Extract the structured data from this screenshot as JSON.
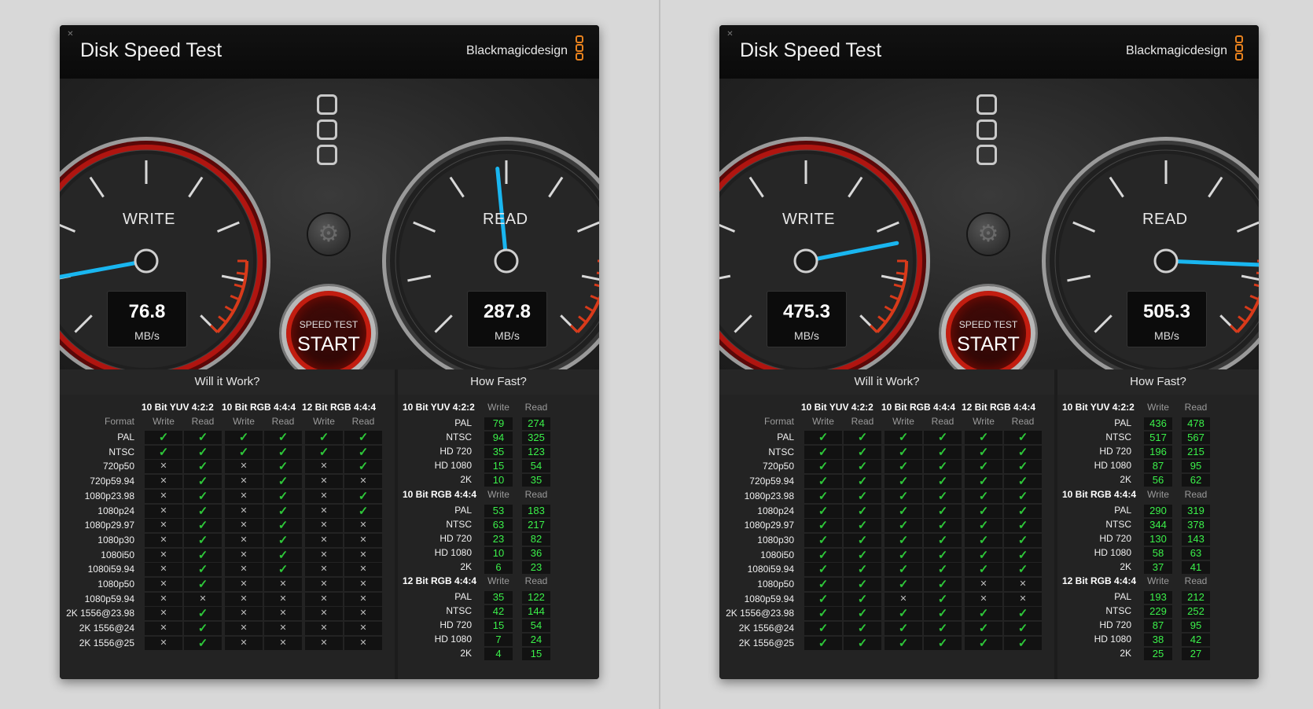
{
  "windows": [
    {
      "title": "Disk Speed Test",
      "brand": "Blackmagicdesign",
      "write": {
        "label": "WRITE",
        "value": "76.8",
        "unit": "MB/s",
        "speed": 76.8
      },
      "read": {
        "label": "READ",
        "value": "287.8",
        "unit": "MB/s",
        "speed": 287.8
      },
      "start": {
        "small": "SPEED TEST",
        "big": "START"
      },
      "will_it_work": {
        "title": "Will it Work?",
        "format_label": "Format",
        "groups": [
          "10 Bit YUV 4:2:2",
          "10 Bit RGB 4:4:4",
          "12 Bit RGB 4:4:4"
        ],
        "subheads": [
          "Write",
          "Read"
        ],
        "rows": [
          {
            "format": "PAL",
            "v": [
              1,
              1,
              1,
              1,
              1,
              1
            ]
          },
          {
            "format": "NTSC",
            "v": [
              1,
              1,
              1,
              1,
              1,
              1
            ]
          },
          {
            "format": "720p50",
            "v": [
              0,
              1,
              0,
              1,
              0,
              1
            ]
          },
          {
            "format": "720p59.94",
            "v": [
              0,
              1,
              0,
              1,
              0,
              0
            ]
          },
          {
            "format": "1080p23.98",
            "v": [
              0,
              1,
              0,
              1,
              0,
              1
            ]
          },
          {
            "format": "1080p24",
            "v": [
              0,
              1,
              0,
              1,
              0,
              1
            ]
          },
          {
            "format": "1080p29.97",
            "v": [
              0,
              1,
              0,
              1,
              0,
              0
            ]
          },
          {
            "format": "1080p30",
            "v": [
              0,
              1,
              0,
              1,
              0,
              0
            ]
          },
          {
            "format": "1080i50",
            "v": [
              0,
              1,
              0,
              1,
              0,
              0
            ]
          },
          {
            "format": "1080i59.94",
            "v": [
              0,
              1,
              0,
              1,
              0,
              0
            ]
          },
          {
            "format": "1080p50",
            "v": [
              0,
              1,
              0,
              0,
              0,
              0
            ]
          },
          {
            "format": "1080p59.94",
            "v": [
              0,
              0,
              0,
              0,
              0,
              0
            ]
          },
          {
            "format": "2K 1556@23.98",
            "v": [
              0,
              1,
              0,
              0,
              0,
              0
            ]
          },
          {
            "format": "2K 1556@24",
            "v": [
              0,
              1,
              0,
              0,
              0,
              0
            ]
          },
          {
            "format": "2K 1556@25",
            "v": [
              0,
              1,
              0,
              0,
              0,
              0
            ]
          }
        ]
      },
      "how_fast": {
        "title": "How Fast?",
        "subheads": [
          "Write",
          "Read"
        ],
        "sections": [
          {
            "name": "10 Bit YUV 4:2:2",
            "rows": [
              [
                "PAL",
                "79",
                "274"
              ],
              [
                "NTSC",
                "94",
                "325"
              ],
              [
                "HD 720",
                "35",
                "123"
              ],
              [
                "HD 1080",
                "15",
                "54"
              ],
              [
                "2K",
                "10",
                "35"
              ]
            ]
          },
          {
            "name": "10 Bit RGB 4:4:4",
            "rows": [
              [
                "PAL",
                "53",
                "183"
              ],
              [
                "NTSC",
                "63",
                "217"
              ],
              [
                "HD 720",
                "23",
                "82"
              ],
              [
                "HD 1080",
                "10",
                "36"
              ],
              [
                "2K",
                "6",
                "23"
              ]
            ]
          },
          {
            "name": "12 Bit RGB 4:4:4",
            "rows": [
              [
                "PAL",
                "35",
                "122"
              ],
              [
                "NTSC",
                "42",
                "144"
              ],
              [
                "HD 720",
                "15",
                "54"
              ],
              [
                "HD 1080",
                "7",
                "24"
              ],
              [
                "2K",
                "4",
                "15"
              ]
            ]
          }
        ]
      }
    },
    {
      "title": "Disk Speed Test",
      "brand": "Blackmagicdesign",
      "write": {
        "label": "WRITE",
        "value": "475.3",
        "unit": "MB/s",
        "speed": 475.3
      },
      "read": {
        "label": "READ",
        "value": "505.3",
        "unit": "MB/s",
        "speed": 505.3
      },
      "start": {
        "small": "SPEED TEST",
        "big": "START"
      },
      "will_it_work": {
        "title": "Will it Work?",
        "format_label": "Format",
        "groups": [
          "10 Bit YUV 4:2:2",
          "10 Bit RGB 4:4:4",
          "12 Bit RGB 4:4:4"
        ],
        "subheads": [
          "Write",
          "Read"
        ],
        "rows": [
          {
            "format": "PAL",
            "v": [
              1,
              1,
              1,
              1,
              1,
              1
            ]
          },
          {
            "format": "NTSC",
            "v": [
              1,
              1,
              1,
              1,
              1,
              1
            ]
          },
          {
            "format": "720p50",
            "v": [
              1,
              1,
              1,
              1,
              1,
              1
            ]
          },
          {
            "format": "720p59.94",
            "v": [
              1,
              1,
              1,
              1,
              1,
              1
            ]
          },
          {
            "format": "1080p23.98",
            "v": [
              1,
              1,
              1,
              1,
              1,
              1
            ]
          },
          {
            "format": "1080p24",
            "v": [
              1,
              1,
              1,
              1,
              1,
              1
            ]
          },
          {
            "format": "1080p29.97",
            "v": [
              1,
              1,
              1,
              1,
              1,
              1
            ]
          },
          {
            "format": "1080p30",
            "v": [
              1,
              1,
              1,
              1,
              1,
              1
            ]
          },
          {
            "format": "1080i50",
            "v": [
              1,
              1,
              1,
              1,
              1,
              1
            ]
          },
          {
            "format": "1080i59.94",
            "v": [
              1,
              1,
              1,
              1,
              1,
              1
            ]
          },
          {
            "format": "1080p50",
            "v": [
              1,
              1,
              1,
              1,
              0,
              0
            ]
          },
          {
            "format": "1080p59.94",
            "v": [
              1,
              1,
              0,
              1,
              0,
              0
            ]
          },
          {
            "format": "2K 1556@23.98",
            "v": [
              1,
              1,
              1,
              1,
              1,
              1
            ]
          },
          {
            "format": "2K 1556@24",
            "v": [
              1,
              1,
              1,
              1,
              1,
              1
            ]
          },
          {
            "format": "2K 1556@25",
            "v": [
              1,
              1,
              1,
              1,
              1,
              1
            ]
          }
        ]
      },
      "how_fast": {
        "title": "How Fast?",
        "subheads": [
          "Write",
          "Read"
        ],
        "sections": [
          {
            "name": "10 Bit YUV 4:2:2",
            "rows": [
              [
                "PAL",
                "436",
                "478"
              ],
              [
                "NTSC",
                "517",
                "567"
              ],
              [
                "HD 720",
                "196",
                "215"
              ],
              [
                "HD 1080",
                "87",
                "95"
              ],
              [
                "2K",
                "56",
                "62"
              ]
            ]
          },
          {
            "name": "10 Bit RGB 4:4:4",
            "rows": [
              [
                "PAL",
                "290",
                "319"
              ],
              [
                "NTSC",
                "344",
                "378"
              ],
              [
                "HD 720",
                "130",
                "143"
              ],
              [
                "HD 1080",
                "58",
                "63"
              ],
              [
                "2K",
                "37",
                "41"
              ]
            ]
          },
          {
            "name": "12 Bit RGB 4:4:4",
            "rows": [
              [
                "PAL",
                "193",
                "212"
              ],
              [
                "NTSC",
                "229",
                "252"
              ],
              [
                "HD 720",
                "87",
                "95"
              ],
              [
                "HD 1080",
                "38",
                "42"
              ],
              [
                "2K",
                "25",
                "27"
              ]
            ]
          }
        ]
      }
    }
  ],
  "colors": {
    "needle": "#19b6f0",
    "accent": "#e8821e",
    "ok": "#2ec83a",
    "value": "#3bf04a",
    "redzone": "#d83a1a"
  },
  "icons": {
    "close": "close-icon",
    "gear": "gear-icon",
    "check": "check-icon",
    "cross": "cross-icon"
  }
}
